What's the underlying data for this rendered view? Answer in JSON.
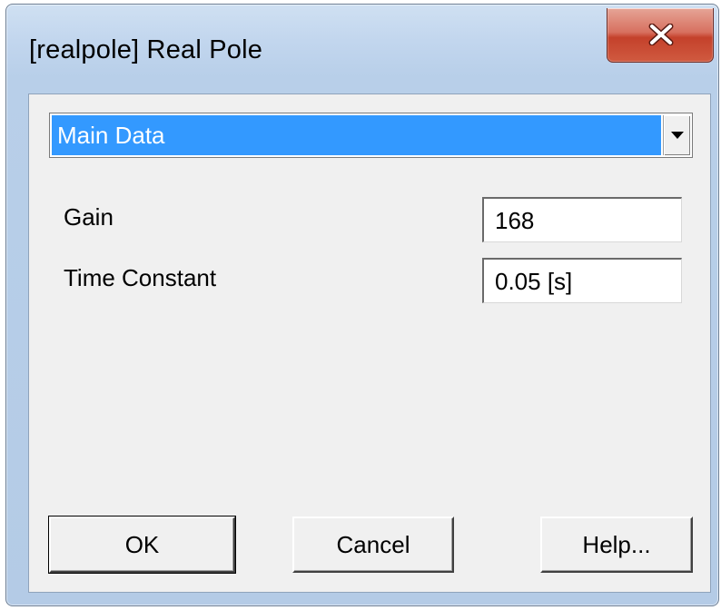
{
  "window": {
    "title": "[realpole] Real Pole",
    "close_icon": "close-x-icon"
  },
  "dropdown": {
    "selected": "Main Data",
    "arrow_icon": "triangle-down-icon"
  },
  "fields": [
    {
      "label": "Gain",
      "value": "168"
    },
    {
      "label": "Time Constant",
      "value": "0.05 [s]"
    }
  ],
  "buttons": {
    "ok": "OK",
    "cancel": "Cancel",
    "help": "Help..."
  },
  "colors": {
    "selection": "#3399ff",
    "close_button": "#c4412b",
    "frame": "#b8cfe9",
    "client_background": "#f0f0f0"
  }
}
